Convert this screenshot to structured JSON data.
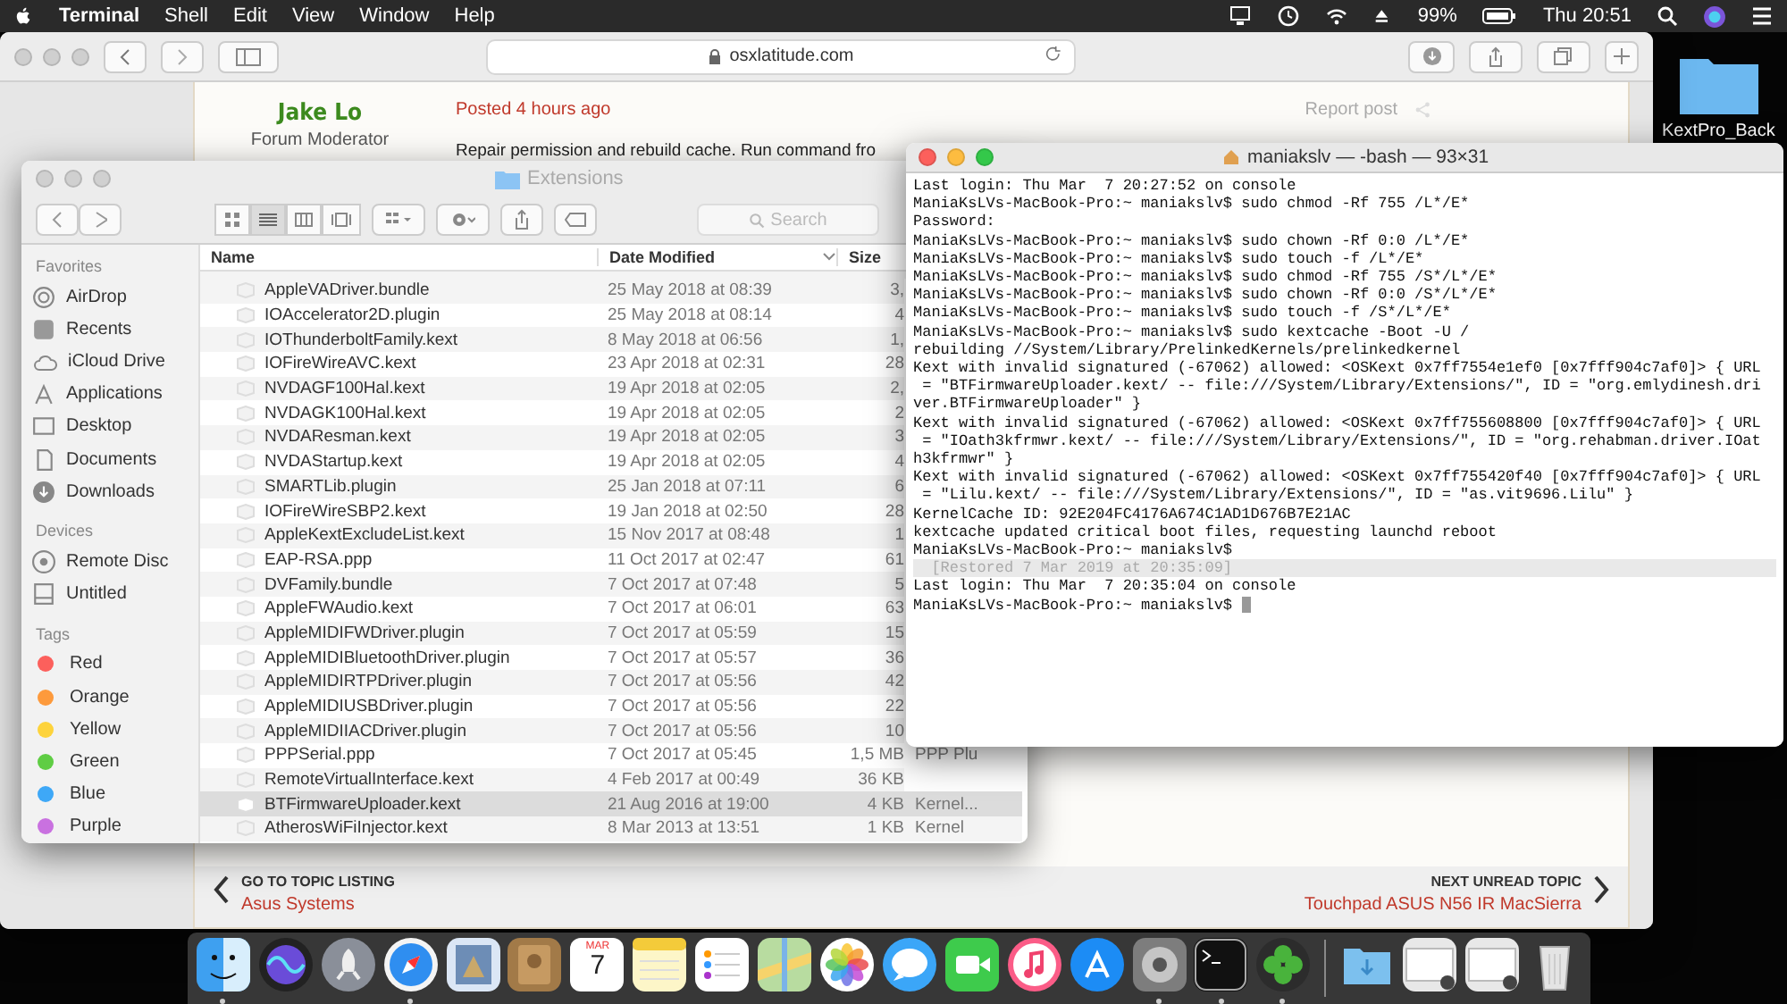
{
  "menu_bar": {
    "app": "Terminal",
    "menus": [
      "Shell",
      "Edit",
      "View",
      "Window",
      "Help"
    ],
    "battery": "99%",
    "clock": "Thu 20:51"
  },
  "desktop": {
    "folder_label": "KextPro_Back"
  },
  "safari": {
    "url": "osxlatitude.com",
    "post": {
      "author": "Jake Lo",
      "role": "Forum Moderator",
      "posted": "Posted 4 hours ago",
      "report": "Report post",
      "body": "Repair permission and rebuild cache. Run command fro"
    },
    "nav": {
      "prev_label": "GO TO TOPIC LISTING",
      "prev_title": "Asus Systems",
      "next_label": "NEXT UNREAD TOPIC",
      "next_title": "Touchpad ASUS N56 IR MacSierra"
    }
  },
  "finder": {
    "title": "Extensions",
    "search_placeholder": "Search",
    "view_modes": [
      {
        "kind": "icons",
        "selected": false
      },
      {
        "kind": "list",
        "selected": true
      },
      {
        "kind": "columns",
        "selected": false
      },
      {
        "kind": "gallery",
        "selected": false
      }
    ],
    "sidebar": [
      {
        "heading": "Favorites",
        "items": [
          {
            "label": "AirDrop",
            "kind": "airdrop"
          },
          {
            "label": "Recents",
            "kind": "recents"
          },
          {
            "label": "iCloud Drive",
            "kind": "cloud"
          },
          {
            "label": "Applications",
            "kind": "apps"
          },
          {
            "label": "Desktop",
            "kind": "desktop"
          },
          {
            "label": "Documents",
            "kind": "documents"
          },
          {
            "label": "Downloads",
            "kind": "downloads"
          }
        ]
      },
      {
        "heading": "Devices",
        "items": [
          {
            "label": "Remote Disc",
            "kind": "disc"
          },
          {
            "label": "Untitled",
            "kind": "drive"
          }
        ]
      },
      {
        "heading": "Tags",
        "items": [
          {
            "label": "Red",
            "kind": "tag",
            "color": "#fc605c"
          },
          {
            "label": "Orange",
            "kind": "tag",
            "color": "#fd9a3c"
          },
          {
            "label": "Yellow",
            "kind": "tag",
            "color": "#fdd33c"
          },
          {
            "label": "Green",
            "kind": "tag",
            "color": "#5fcd44"
          },
          {
            "label": "Blue",
            "kind": "tag",
            "color": "#3ea8f7"
          },
          {
            "label": "Purple",
            "kind": "tag",
            "color": "#c971e0"
          }
        ]
      }
    ],
    "columns": [
      "Name",
      "Date Modified",
      "Size"
    ],
    "rows": [
      {
        "name": "AppleVADriver.bundle",
        "date": "25 May 2018 at 08:39",
        "size": "3,",
        "selected": false
      },
      {
        "name": "IOAccelerator2D.plugin",
        "date": "25 May 2018 at 08:14",
        "size": "4",
        "selected": false
      },
      {
        "name": "IOThunderboltFamily.kext",
        "date": "8 May 2018 at 06:56",
        "size": "1,",
        "selected": false
      },
      {
        "name": "IOFireWireAVC.kext",
        "date": "23 Apr 2018 at 02:31",
        "size": "28",
        "selected": false
      },
      {
        "name": "NVDAGF100Hal.kext",
        "date": "19 Apr 2018 at 02:05",
        "size": "2,",
        "selected": false
      },
      {
        "name": "NVDAGK100Hal.kext",
        "date": "19 Apr 2018 at 02:05",
        "size": "2",
        "selected": false
      },
      {
        "name": "NVDAResman.kext",
        "date": "19 Apr 2018 at 02:05",
        "size": "3",
        "selected": false
      },
      {
        "name": "NVDAStartup.kext",
        "date": "19 Apr 2018 at 02:05",
        "size": "4",
        "selected": false
      },
      {
        "name": "SMARTLib.plugin",
        "date": "25 Jan 2018 at 07:11",
        "size": "6",
        "selected": false
      },
      {
        "name": "IOFireWireSBP2.kext",
        "date": "19 Jan 2018 at 02:50",
        "size": "28",
        "selected": false
      },
      {
        "name": "AppleKextExcludeList.kext",
        "date": "15 Nov 2017 at 08:48",
        "size": "1",
        "selected": false
      },
      {
        "name": "EAP-RSA.ppp",
        "date": "11 Oct 2017 at 02:47",
        "size": "61",
        "selected": false
      },
      {
        "name": "DVFamily.bundle",
        "date": "7 Oct 2017 at 07:48",
        "size": "5",
        "selected": false
      },
      {
        "name": "AppleFWAudio.kext",
        "date": "7 Oct 2017 at 06:01",
        "size": "63",
        "selected": false
      },
      {
        "name": "AppleMIDIFWDriver.plugin",
        "date": "7 Oct 2017 at 05:59",
        "size": "15",
        "selected": false
      },
      {
        "name": "AppleMIDIBluetoothDriver.plugin",
        "date": "7 Oct 2017 at 05:57",
        "size": "36",
        "selected": false
      },
      {
        "name": "AppleMIDIRTPDriver.plugin",
        "date": "7 Oct 2017 at 05:56",
        "size": "42",
        "selected": false
      },
      {
        "name": "AppleMIDIUSBDriver.plugin",
        "date": "7 Oct 2017 at 05:56",
        "size": "22",
        "selected": false
      },
      {
        "name": "AppleMIDIIACDriver.plugin",
        "date": "7 Oct 2017 at 05:56",
        "size": "10",
        "selected": false
      },
      {
        "name": "PPPSerial.ppp",
        "date": "7 Oct 2017 at 05:45",
        "size": "1,5 MB",
        "kind": "PPP Plu",
        "selected": false
      },
      {
        "name": "RemoteVirtualInterface.kext",
        "date": "4 Feb 2017 at 00:49",
        "size": "36 KB",
        "selected": false
      },
      {
        "name": "BTFirmwareUploader.kext",
        "date": "21 Aug 2016 at 19:00",
        "size": "4 KB",
        "kind": "Kernel...",
        "selected": true
      },
      {
        "name": "AtherosWiFiInjector.kext",
        "date": "8 Mar 2013 at 13:51",
        "size": "1 KB",
        "kind": "Kernel",
        "selected": false
      }
    ]
  },
  "terminal": {
    "title": "maniakslv — -bash — 93×31",
    "lines": [
      {
        "kind": "output",
        "text": "Last login: Thu Mar  7 20:27:52 on console"
      },
      {
        "kind": "output",
        "text": "ManiaKsLVs-MacBook-Pro:~ maniakslv$ sudo chmod -Rf 755 /L*/E*"
      },
      {
        "kind": "output",
        "text": "Password:"
      },
      {
        "kind": "output",
        "text": "ManiaKsLVs-MacBook-Pro:~ maniakslv$ sudo chown -Rf 0:0 /L*/E*"
      },
      {
        "kind": "output",
        "text": "ManiaKsLVs-MacBook-Pro:~ maniakslv$ sudo touch -f /L*/E*"
      },
      {
        "kind": "output",
        "text": "ManiaKsLVs-MacBook-Pro:~ maniakslv$ sudo chmod -Rf 755 /S*/L*/E*"
      },
      {
        "kind": "output",
        "text": "ManiaKsLVs-MacBook-Pro:~ maniakslv$ sudo chown -Rf 0:0 /S*/L*/E*"
      },
      {
        "kind": "output",
        "text": "ManiaKsLVs-MacBook-Pro:~ maniakslv$ sudo touch -f /S*/L*/E*"
      },
      {
        "kind": "output",
        "text": "ManiaKsLVs-MacBook-Pro:~ maniakslv$ sudo kextcache -Boot -U /"
      },
      {
        "kind": "output",
        "text": "rebuilding //System/Library/PrelinkedKernels/prelinkedkernel"
      },
      {
        "kind": "output",
        "text": "Kext with invalid signatured (-67062) allowed: <OSKext 0x7ff7554e1ef0 [0x7fff904c7af0]> { URL"
      },
      {
        "kind": "output",
        "text": " = \"BTFirmwareUploader.kext/ -- file:///System/Library/Extensions/\", ID = \"org.emlydinesh.dri"
      },
      {
        "kind": "output",
        "text": "ver.BTFirmwareUploader\" }"
      },
      {
        "kind": "output",
        "text": "Kext with invalid signatured (-67062) allowed: <OSKext 0x7ff755608800 [0x7fff904c7af0]> { URL"
      },
      {
        "kind": "output",
        "text": " = \"IOath3kfrmwr.kext/ -- file:///System/Library/Extensions/\", ID = \"org.rehabman.driver.IOat"
      },
      {
        "kind": "output",
        "text": "h3kfrmwr\" }"
      },
      {
        "kind": "output",
        "text": "Kext with invalid signatured (-67062) allowed: <OSKext 0x7ff755420f40 [0x7fff904c7af0]> { URL"
      },
      {
        "kind": "output",
        "text": " = \"Lilu.kext/ -- file:///System/Library/Extensions/\", ID = \"as.vit9696.Lilu\" }"
      },
      {
        "kind": "output",
        "text": "KernelCache ID: 92E204FC4176A674C1AD1D676B7E21AC"
      },
      {
        "kind": "output",
        "text": "kextcache updated critical boot files, requesting launchd reboot"
      },
      {
        "kind": "output",
        "text": "ManiaKsLVs-MacBook-Pro:~ maniakslv$"
      },
      {
        "kind": "restored",
        "text": "  [Restored 7 Mar 2019 at 20:35:09]"
      },
      {
        "kind": "output",
        "text": "Last login: Thu Mar  7 20:35:04 on console"
      },
      {
        "kind": "prompt",
        "text": "ManiaKsLVs-MacBook-Pro:~ maniakslv$"
      }
    ]
  },
  "dock": [
    {
      "kind": "finder",
      "running": true
    },
    {
      "kind": "siri",
      "running": false
    },
    {
      "kind": "launchpad",
      "running": false
    },
    {
      "kind": "safari",
      "running": true
    },
    {
      "kind": "mail",
      "running": false
    },
    {
      "kind": "contacts",
      "running": false
    },
    {
      "kind": "calendar",
      "month": "MAR",
      "day": "7",
      "running": false
    },
    {
      "kind": "notes",
      "running": false
    },
    {
      "kind": "reminders",
      "running": false
    },
    {
      "kind": "maps",
      "running": false
    },
    {
      "kind": "photos",
      "running": false
    },
    {
      "kind": "messages",
      "running": false
    },
    {
      "kind": "facetime",
      "running": false
    },
    {
      "kind": "music",
      "running": false
    },
    {
      "kind": "appstore",
      "running": false
    },
    {
      "kind": "settings",
      "running": true
    },
    {
      "kind": "terminal",
      "running": true
    },
    {
      "kind": "clover",
      "running": true
    },
    {
      "kind": "separator"
    },
    {
      "kind": "downloads"
    },
    {
      "kind": "thumbnail"
    },
    {
      "kind": "thumbnail"
    },
    {
      "kind": "trash"
    }
  ]
}
